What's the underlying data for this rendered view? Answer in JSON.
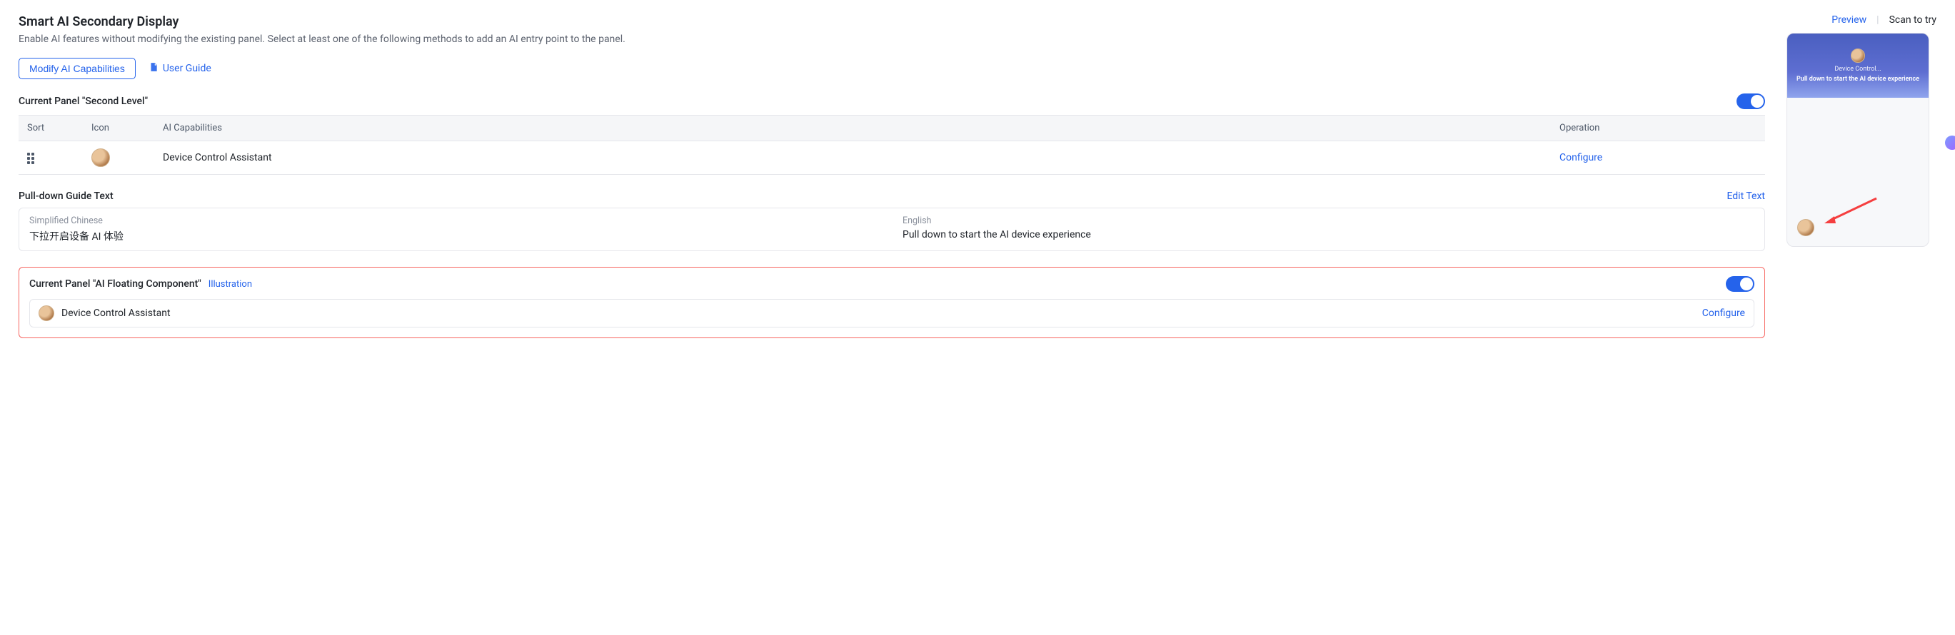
{
  "header": {
    "title": "Smart AI Secondary Display",
    "subtitle": "Enable AI features without modifying the existing panel. Select at least one of the following methods to add an AI entry point to the panel."
  },
  "actions": {
    "modify": "Modify AI Capabilities",
    "userGuide": "User Guide"
  },
  "secondLevel": {
    "label": "Current Panel \"Second Level\"",
    "toggle": true,
    "columns": {
      "sort": "Sort",
      "icon": "Icon",
      "cap": "AI Capabilities",
      "op": "Operation"
    },
    "rows": [
      {
        "cap": "Device Control Assistant",
        "op": "Configure"
      }
    ]
  },
  "pulldown": {
    "label": "Pull-down Guide Text",
    "editText": "Edit Text",
    "langs": {
      "zhLabel": "Simplified Chinese",
      "zh": "下拉开启设备 AI 体验",
      "enLabel": "English",
      "en": "Pull down to start the AI device experience"
    }
  },
  "floating": {
    "label": "Current Panel \"AI Floating Component\"",
    "illustration": "Illustration",
    "toggle": true,
    "item": {
      "name": "Device Control Assistant",
      "configure": "Configure"
    }
  },
  "side": {
    "preview": "Preview",
    "scan": "Scan to try",
    "previewLabel": "Device Control...",
    "previewText": "Pull down to start the AI device experience"
  }
}
